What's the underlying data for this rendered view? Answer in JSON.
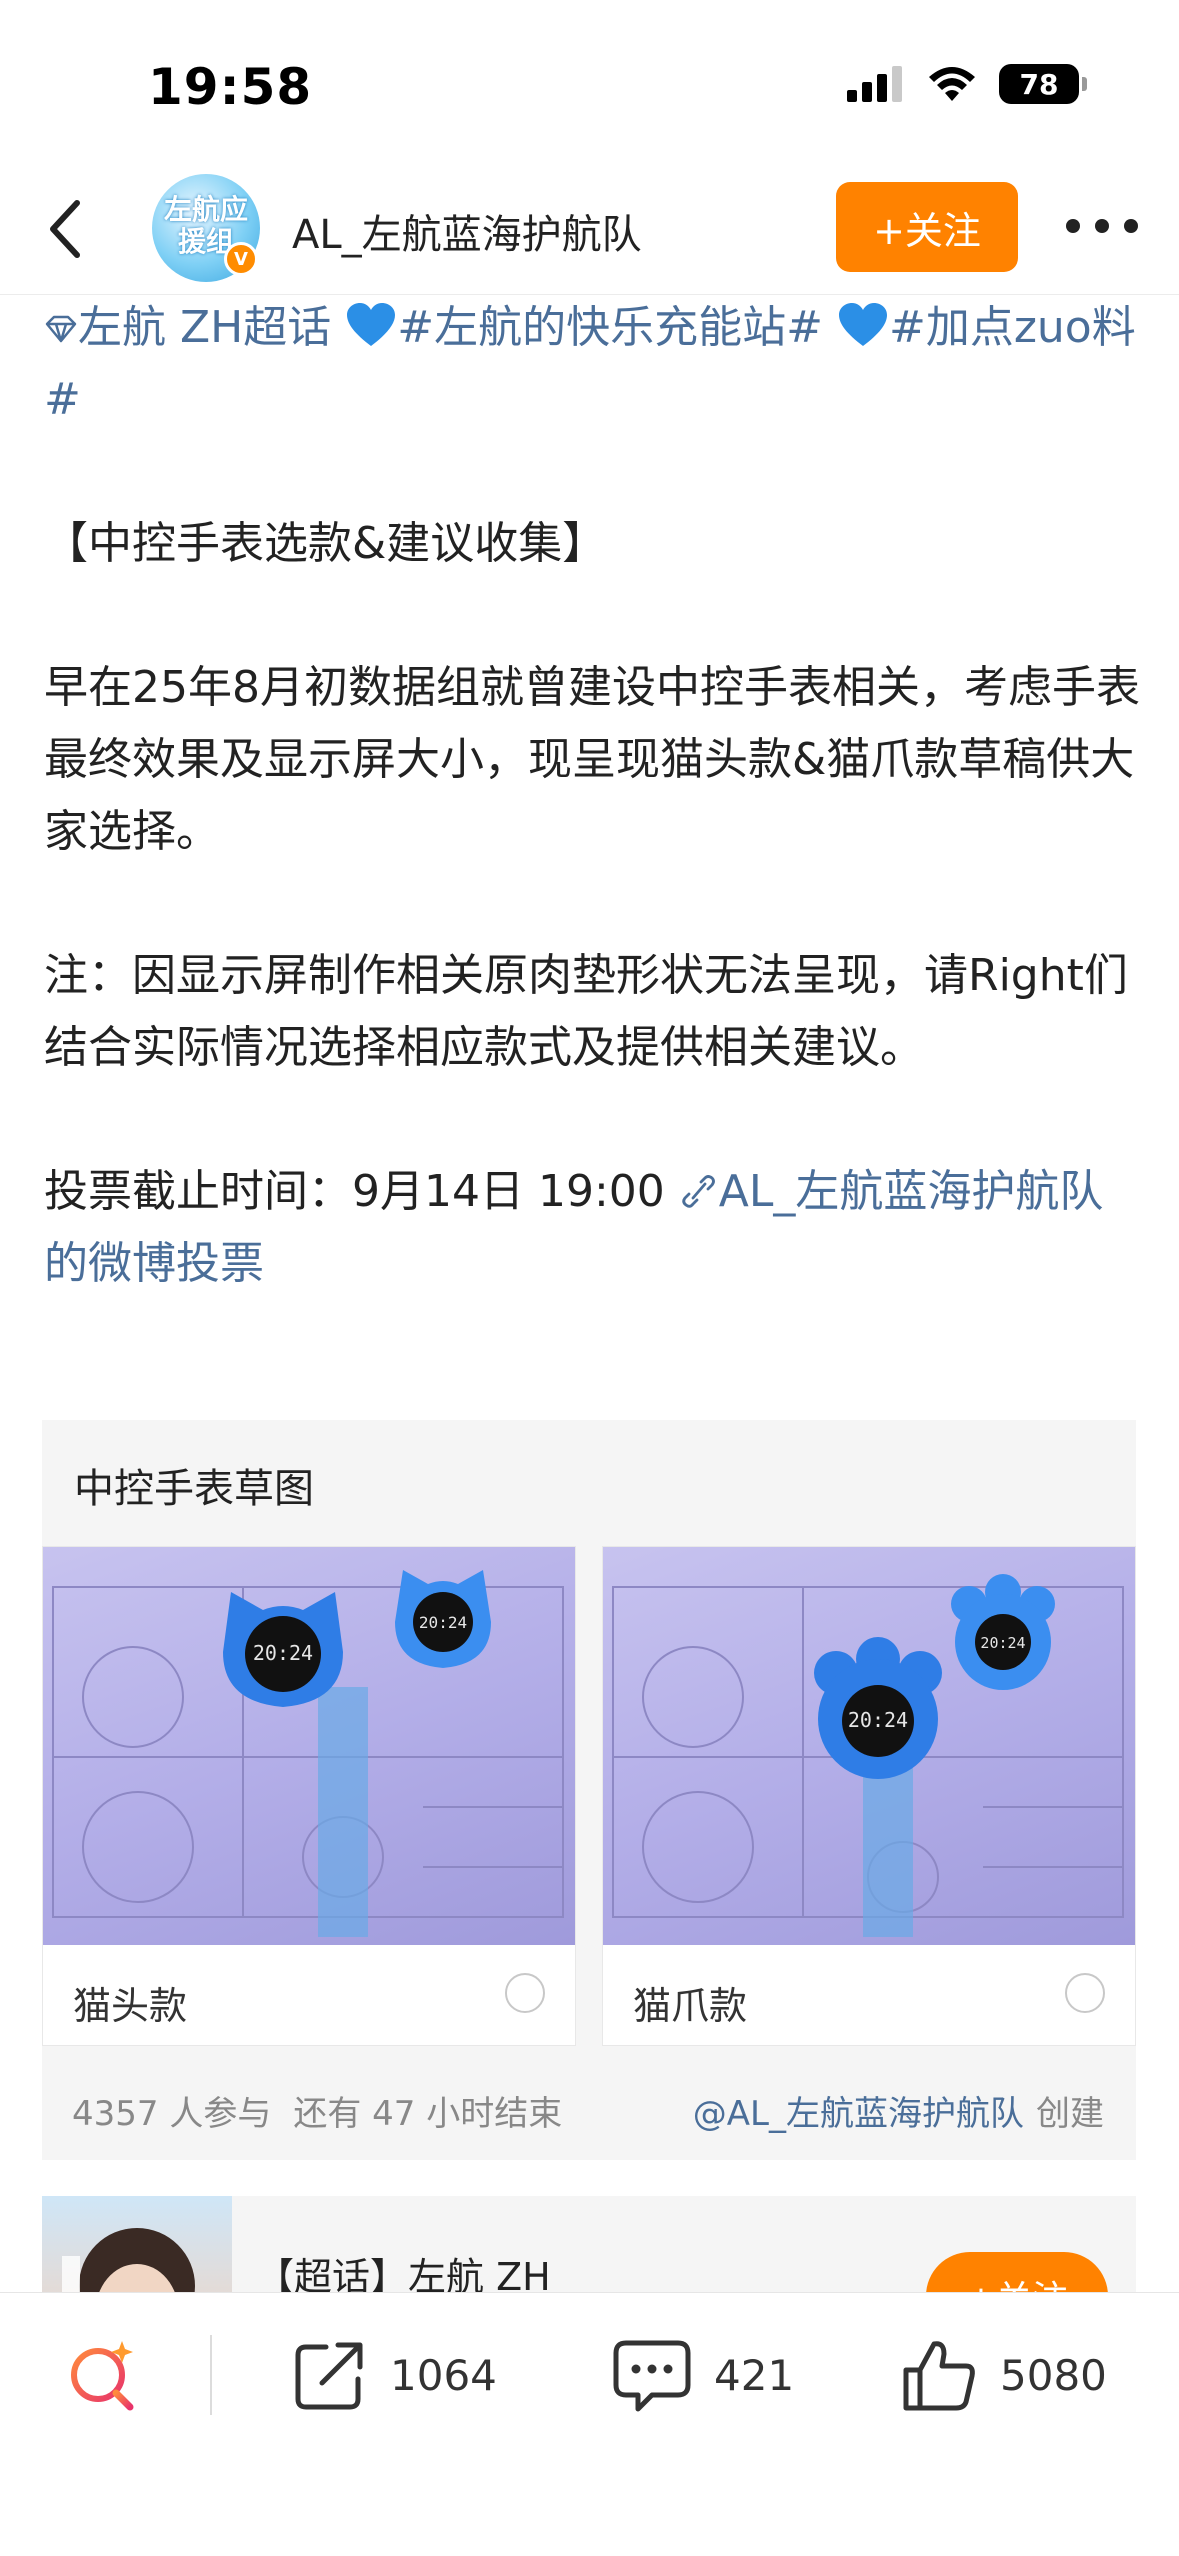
{
  "status_bar": {
    "time": "19:58",
    "battery": "78"
  },
  "nav": {
    "avatar_text": "左航应援组",
    "title": "AL_左航蓝海护航队",
    "follow_label": "+关注"
  },
  "post": {
    "topic_line_1": "左航 ZH超话",
    "topic_hash_1": "#左航的快乐充能站#",
    "topic_hash_2": "#加点zuo料#",
    "heading": "【中控手表选款&建议收集】",
    "para1": "早在25年8月初数据组就曾建设中控手表相关，考虑手表最终效果及显示屏大小，现呈现猫头款&猫爪款草稿供大家选择。",
    "para2": "注：因显示屏制作相关原肉垫形状无法呈现，请Right们结合实际情况选择相应款式及提供相关建议。",
    "deadline": "投票截止时间：9月14日 19:00",
    "poll_link": "AL_左航蓝海护航队的微博投票"
  },
  "poll": {
    "title": "中控手表草图",
    "options": [
      {
        "label": "猫头款",
        "watch_text": "20:24"
      },
      {
        "label": "猫爪款",
        "watch_text": "20:24"
      }
    ],
    "participants": "4357 人参与",
    "remaining": "还有 47 小时结束",
    "creator": "@AL_左航蓝海护航队",
    "created": "创建"
  },
  "topic_card": {
    "title": "【超话】左航 ZH",
    "follow_label": "+关注"
  },
  "bottom_bar": {
    "shares": "1064",
    "comments": "421",
    "likes": "5080"
  },
  "colors": {
    "accent_orange": "#ff8200",
    "link_blue": "#4a6e99",
    "heart_blue": "#2b8fe6"
  }
}
